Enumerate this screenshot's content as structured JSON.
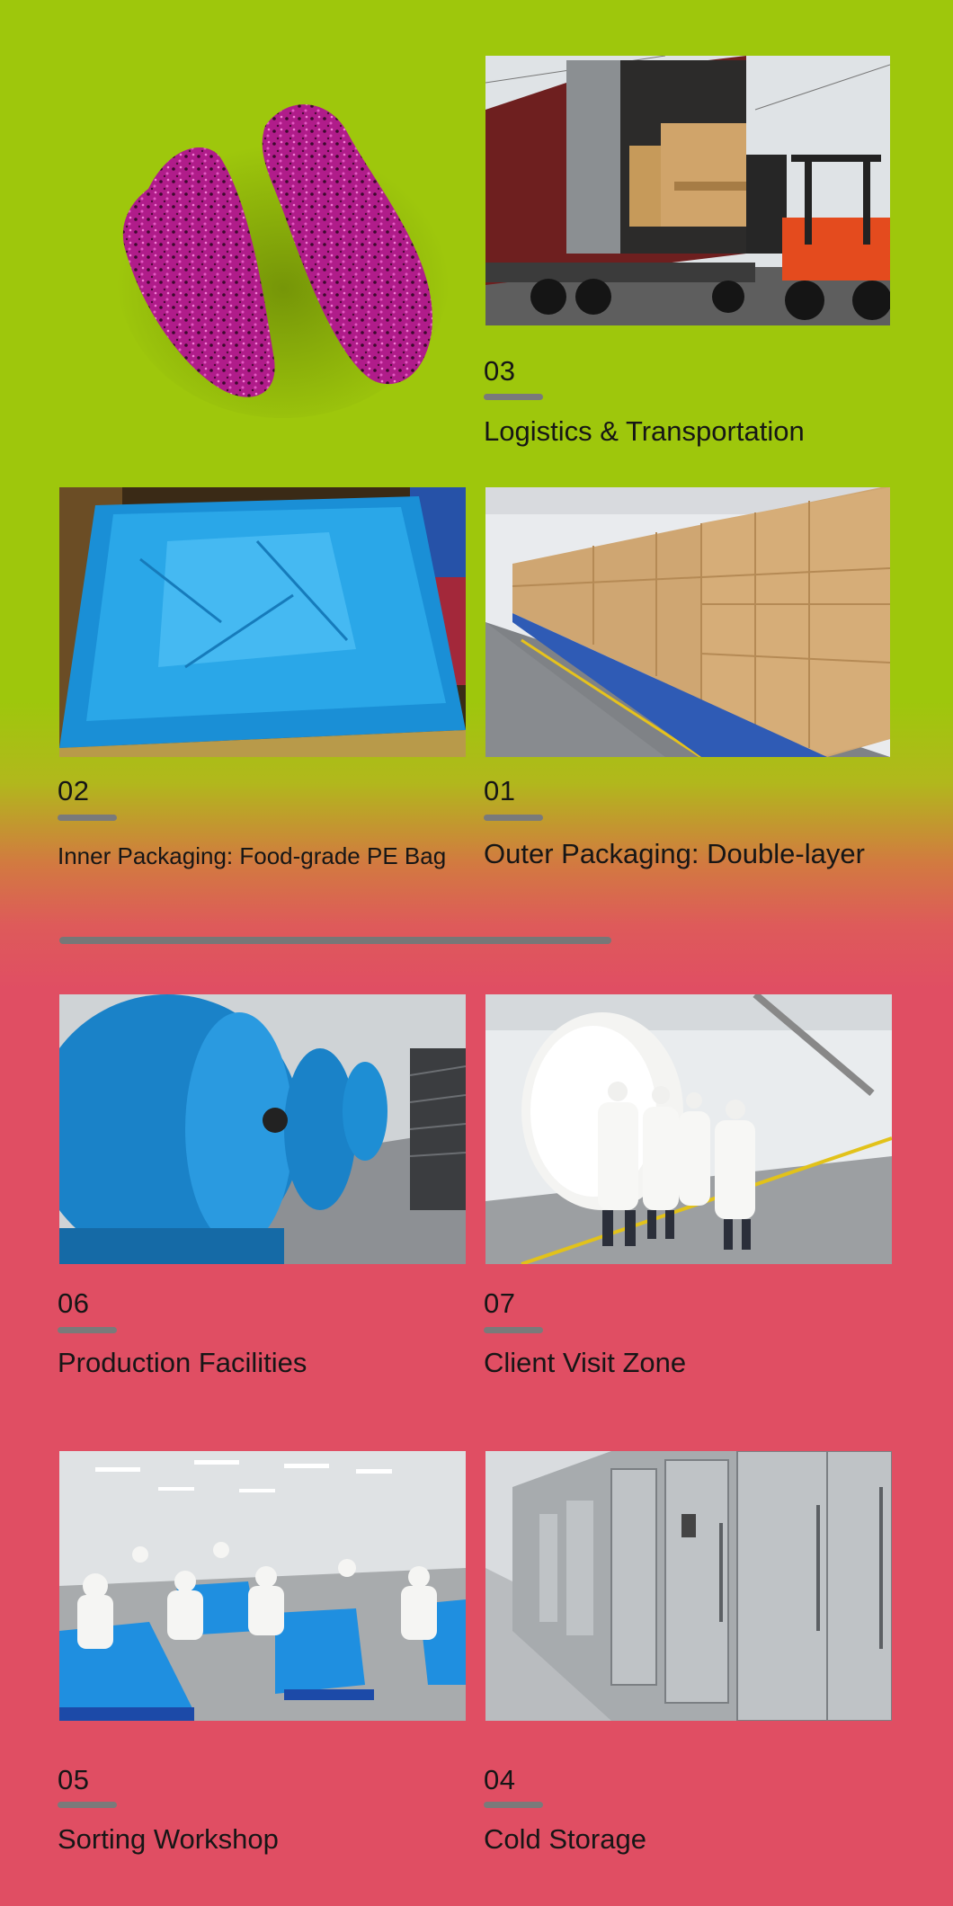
{
  "colors": {
    "lime_background": "#9ec70c",
    "red_background": "#e04e63",
    "accent_rule": "#7a7a7a"
  },
  "hero": {
    "subject": "freeze-dried red dragon fruit slices"
  },
  "sections": [
    {
      "number": "03",
      "title": "Logistics & Transportation",
      "icon": "truck-loading-photo"
    },
    {
      "number": "02",
      "title": "Inner Packaging: Food-grade PE Bag",
      "icon": "blue-pe-bag-photo"
    },
    {
      "number": "01",
      "title": "Outer Packaging: Double-layer",
      "icon": "carton-stack-photo"
    },
    {
      "number": "06",
      "title": "Production Facilities",
      "icon": "freeze-dryer-tanks-photo"
    },
    {
      "number": "07",
      "title": "Client Visit Zone",
      "icon": "client-visit-photo"
    },
    {
      "number": "05",
      "title": "Sorting Workshop",
      "icon": "sorting-workshop-photo"
    },
    {
      "number": "04",
      "title": "Cold Storage",
      "icon": "cold-storage-photo"
    }
  ]
}
